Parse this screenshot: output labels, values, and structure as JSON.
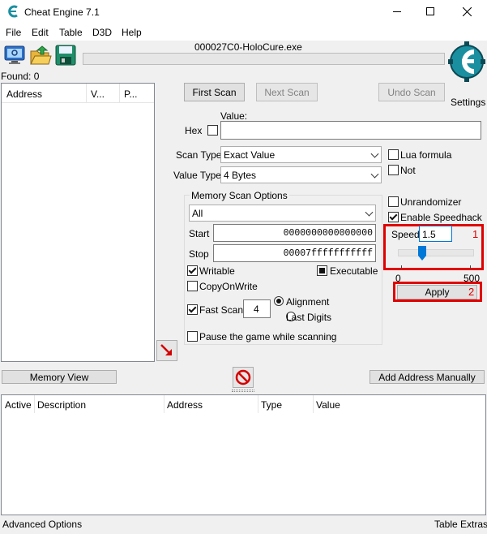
{
  "window": {
    "title": "Cheat Engine 7.1"
  },
  "menu": [
    "File",
    "Edit",
    "Table",
    "D3D",
    "Help"
  ],
  "process_name": "000027C0-HoloCure.exe",
  "found_label": "Found: 0",
  "results_columns": [
    "Address",
    "V...",
    "P..."
  ],
  "scan": {
    "first_scan": "First Scan",
    "next_scan": "Next Scan",
    "undo_scan": "Undo Scan",
    "value_label": "Value:",
    "hex_label": "Hex",
    "scan_type_label": "Scan Type",
    "scan_type_value": "Exact Value",
    "value_type_label": "Value Type",
    "value_type_value": "4 Bytes",
    "lua_formula": "Lua formula",
    "not_label": "Not"
  },
  "settings_label": "Settings",
  "memory_options": {
    "title": "Memory Scan Options",
    "region": "All",
    "start_label": "Start",
    "start_value": "0000000000000000",
    "stop_label": "Stop",
    "stop_value": "00007fffffffffff",
    "writable": "Writable",
    "executable": "Executable",
    "copy_on_write": "CopyOnWrite",
    "fast_scan": "Fast Scan",
    "fast_scan_value": "4",
    "alignment": "Alignment",
    "last_digits": "Last Digits",
    "pause_game": "Pause the game while scanning"
  },
  "speedhack": {
    "unrandomizer": "Unrandomizer",
    "enable_speedhack": "Enable Speedhack",
    "speed_label": "Speed",
    "speed_value": "1.5",
    "slider_fraction": 0.06,
    "slider_min": "0",
    "slider_max": "500",
    "apply": "Apply",
    "annotation_1": "1",
    "annotation_2": "2"
  },
  "memory_view": "Memory View",
  "add_address_manually": "Add Address Manually",
  "table_columns": [
    "Active",
    "Description",
    "Address",
    "Type",
    "Value"
  ],
  "footer": {
    "advanced_options": "Advanced Options",
    "table_extras": "Table Extras"
  },
  "colors": {
    "annotation_red": "#e00000",
    "logo_teal": "#1a8fa0"
  }
}
